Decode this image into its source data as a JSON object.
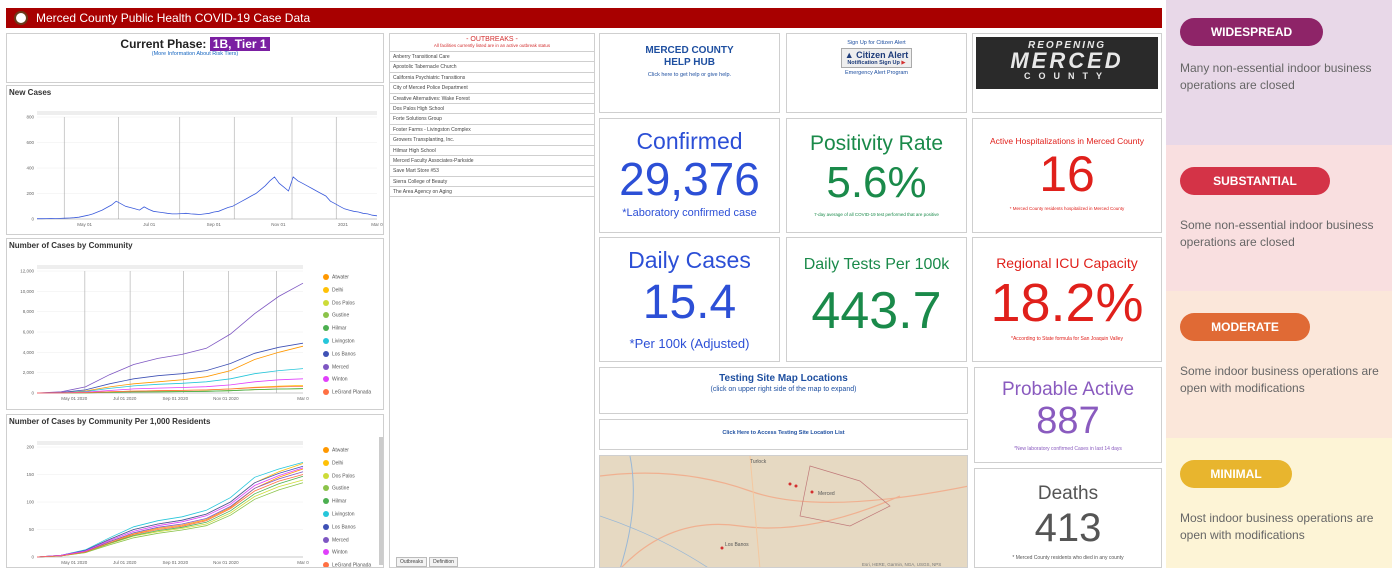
{
  "header": {
    "title": "Merced County Public Health COVID-19 Case Data"
  },
  "phase": {
    "label": "Current Phase:",
    "value": "1B, Tier 1",
    "sub": "(More Information About Risk Tiers)"
  },
  "new_cases": {
    "title": "New Cases",
    "chart_data": {
      "type": "line",
      "yticks": [
        "800",
        "600",
        "400",
        "200",
        "0"
      ],
      "xticks": [
        "May 01",
        "Jul 01",
        "Sep 01",
        "Nov 01",
        "2021",
        "Mar 0"
      ],
      "ylim": [
        0,
        800
      ],
      "series": [
        {
          "values": [
            2,
            2,
            3,
            4,
            3,
            5,
            6,
            8,
            10,
            14,
            22,
            30,
            40,
            55,
            70,
            90,
            110,
            140,
            120,
            100,
            90,
            80,
            70,
            95,
            75,
            60,
            55,
            50,
            45,
            40,
            40,
            42,
            45,
            40,
            38,
            35,
            40,
            45,
            55,
            60,
            75,
            90,
            100,
            120,
            140,
            160,
            180,
            200,
            230,
            260,
            300,
            330,
            280,
            250,
            220,
            330,
            300,
            280,
            260,
            240,
            220,
            200,
            180,
            140,
            120,
            100,
            80,
            70,
            60,
            55,
            45,
            40,
            30,
            25
          ]
        }
      ]
    }
  },
  "community": {
    "title": "Number of Cases by Community",
    "chart_data": {
      "type": "line",
      "yticks": [
        "12,000",
        "10,000",
        "8,000",
        "6,000",
        "4,000",
        "2,000",
        "0"
      ],
      "xticks": [
        "May 01 2020",
        "Jul 01 2020",
        "Sep 01 2020",
        "Nov 01 2020",
        "Mar 0"
      ],
      "ylim": [
        0,
        12000
      ],
      "legend": [
        "Atwater",
        "Delhi",
        "Dos Palos",
        "Gustine",
        "Hilmar",
        "Livingston",
        "Los Banos",
        "Merced",
        "Winton",
        "LeGrand Planada"
      ],
      "colors": [
        "#ff9800",
        "#ffc107",
        "#cddc39",
        "#8bc34a",
        "#4caf50",
        "#26c6da",
        "#3f51b5",
        "#7e57c2",
        "#e040fb",
        "#ff7043"
      ],
      "series": [
        {
          "name": "Atwater",
          "values": [
            0,
            40,
            200,
            600,
            900,
            1100,
            1300,
            1600,
            2200,
            3300,
            4000,
            4600
          ]
        },
        {
          "name": "Delhi",
          "values": [
            0,
            10,
            40,
            120,
            190,
            230,
            260,
            300,
            400,
            560,
            680,
            750
          ]
        },
        {
          "name": "Dos Palos",
          "values": [
            0,
            5,
            25,
            70,
            110,
            140,
            160,
            190,
            250,
            330,
            390,
            430
          ]
        },
        {
          "name": "Gustine",
          "values": [
            0,
            5,
            20,
            60,
            100,
            120,
            140,
            170,
            230,
            320,
            380,
            420
          ]
        },
        {
          "name": "Hilmar",
          "values": [
            0,
            5,
            20,
            60,
            95,
            120,
            140,
            170,
            230,
            330,
            390,
            430
          ]
        },
        {
          "name": "Livingston",
          "values": [
            0,
            30,
            150,
            450,
            700,
            860,
            950,
            1100,
            1400,
            1900,
            2200,
            2400
          ]
        },
        {
          "name": "Los Banos",
          "values": [
            0,
            60,
            300,
            900,
            1400,
            1700,
            1900,
            2200,
            2900,
            3900,
            4500,
            4900
          ]
        },
        {
          "name": "Merced",
          "values": [
            0,
            120,
            600,
            1800,
            2800,
            3400,
            3800,
            4400,
            5800,
            7800,
            9500,
            10800
          ]
        },
        {
          "name": "Winton",
          "values": [
            0,
            20,
            80,
            250,
            400,
            480,
            540,
            620,
            800,
            1100,
            1300,
            1400
          ]
        },
        {
          "name": "LeGrand Planada",
          "values": [
            0,
            10,
            40,
            120,
            190,
            230,
            260,
            300,
            390,
            520,
            600,
            650
          ]
        }
      ]
    }
  },
  "per_1000": {
    "title": "Number of Cases by Community Per 1,000 Residents",
    "chart_data": {
      "type": "line",
      "yticks": [
        "200",
        "150",
        "100",
        "50",
        "0"
      ],
      "xticks": [
        "May 01 2020",
        "Jul 01 2020",
        "Sep 01 2020",
        "Nov 01 2020",
        "Mar 0"
      ],
      "ylim": [
        0,
        200
      ],
      "legend": [
        "Atwater",
        "Delhi",
        "Dos Palos",
        "Gustine",
        "Hilmar",
        "Livingston",
        "Los Banos",
        "Merced",
        "Winton",
        "LeGrand Planada"
      ],
      "colors": [
        "#ff9800",
        "#ffc107",
        "#cddc39",
        "#8bc34a",
        "#4caf50",
        "#26c6da",
        "#3f51b5",
        "#7e57c2",
        "#e040fb",
        "#ff7043"
      ],
      "series": [
        {
          "name": "Atwater",
          "values": [
            0,
            2,
            10,
            28,
            42,
            52,
            58,
            68,
            90,
            125,
            145,
            160
          ]
        },
        {
          "name": "Delhi",
          "values": [
            0,
            3,
            12,
            32,
            50,
            60,
            67,
            78,
            100,
            135,
            155,
            170
          ]
        },
        {
          "name": "Dos Palos",
          "values": [
            0,
            2,
            8,
            24,
            38,
            46,
            52,
            60,
            80,
            110,
            128,
            140
          ]
        },
        {
          "name": "Gustine",
          "values": [
            0,
            2,
            8,
            22,
            35,
            43,
            49,
            57,
            76,
            105,
            122,
            135
          ]
        },
        {
          "name": "Hilmar",
          "values": [
            0,
            2,
            9,
            25,
            39,
            48,
            54,
            63,
            84,
            115,
            133,
            147
          ]
        },
        {
          "name": "Livingston",
          "values": [
            0,
            3,
            13,
            35,
            55,
            66,
            73,
            85,
            108,
            145,
            160,
            172
          ]
        },
        {
          "name": "Los Banos",
          "values": [
            0,
            3,
            12,
            32,
            50,
            60,
            67,
            78,
            100,
            135,
            152,
            165
          ]
        },
        {
          "name": "Merced",
          "values": [
            0,
            2,
            10,
            28,
            44,
            54,
            60,
            70,
            92,
            125,
            142,
            155
          ]
        },
        {
          "name": "Winton",
          "values": [
            0,
            3,
            11,
            30,
            47,
            57,
            64,
            75,
            96,
            130,
            148,
            162
          ]
        },
        {
          "name": "LeGrand Planada",
          "values": [
            0,
            2,
            9,
            26,
            41,
            50,
            56,
            66,
            88,
            120,
            138,
            150
          ]
        }
      ]
    }
  },
  "outbreaks": {
    "title": "- OUTBREAKS -",
    "subtitle": "All facilities currently listed are in an active outbreak status",
    "items": [
      "Anberry Transitional Care",
      "Apostolic Tabernacle Church",
      "California Psychiatric Transitions",
      "City of Merced Police Department",
      "Creative Alternatives: Wake Forest",
      "Dos Palos High School",
      "Forte Solutions Group",
      "Foster Farms - Livingston Complex",
      "Growers Transplanting, Inc.",
      "Hilmar High School",
      "Merced Faculty Associates-Parkside",
      "Save Mart Store #53",
      "Sierra College of Beauty",
      "The Area Agency on Aging"
    ],
    "tabs": [
      "Outbreaks",
      "Definition"
    ]
  },
  "hub": {
    "line1": "MERCED COUNTY",
    "line2": "HELP HUB",
    "sub": "Click here to get help or give help."
  },
  "alert": {
    "top": "Sign Up for Citizen Alert",
    "b1": "Citizen Alert",
    "b2": "Notification Sign Up",
    "bottom": "Emergency Alert Program"
  },
  "reopen": {
    "line1": "REOPENING",
    "line2": "MERCED",
    "line3": "COUNTY"
  },
  "stats": {
    "confirmed": {
      "title": "Confirmed",
      "value": "29,376",
      "note": "*Laboratory confirmed case",
      "color": "#2c4fd6"
    },
    "positivity": {
      "title": "Positivity Rate",
      "value": "5.6%",
      "note": "7-day average of all COVID-19 test performed that are positive",
      "color": "#1a8a4a"
    },
    "hospital": {
      "title": "Active Hospitalizations in Merced County",
      "value": "16",
      "note": "* Merced County residents hospitalized in Merced County",
      "color": "#e0201b"
    },
    "daily": {
      "title": "Daily Cases",
      "value": "15.4",
      "note": "*Per 100k (Adjusted)",
      "color": "#2c4fd6"
    },
    "tests": {
      "title": "Daily Tests Per 100k",
      "value": "443.7",
      "note": "",
      "color": "#1a8a4a"
    },
    "icu": {
      "title": "Regional ICU Capacity",
      "value": "18.2%",
      "note": "*According to State formula for San Joaquin Valley",
      "color": "#e0201b"
    },
    "probable": {
      "title": "Probable Active",
      "value": "887",
      "note": "*New laboratory confirmed Cases in last 14 days",
      "color": "#8a5bbf"
    },
    "deaths": {
      "title": "Deaths",
      "value": "413",
      "note": "* Merced County residents who died in any county",
      "color": "#555555"
    }
  },
  "testing": {
    "title": "Testing Site Map Locations",
    "sub": "(click on upper right side of the map to expand)",
    "link": "Click Here to Access Testing Site Location List"
  },
  "map": {
    "labels": [
      "Turlock",
      "Merced",
      "Los Banos"
    ],
    "credits": "Esri, HERE, Garmin, NGA, USGS, NPS"
  },
  "tiers": [
    {
      "name": "WIDESPREAD",
      "desc": "Many non-essential indoor business operations are closed",
      "bg": "#e8d8e8",
      "pill": "#8e2468"
    },
    {
      "name": "SUBSTANTIAL",
      "desc": "Some non-essential indoor business operations are closed",
      "bg": "#f9dfe0",
      "pill": "#d43347"
    },
    {
      "name": "MODERATE",
      "desc": "Some indoor business operations are open with modifications",
      "bg": "#fbe7da",
      "pill": "#e06a35"
    },
    {
      "name": "MINIMAL",
      "desc": "Most indoor business operations are open with modifications",
      "bg": "#fdf4d6",
      "pill": "#e8b52e"
    }
  ]
}
